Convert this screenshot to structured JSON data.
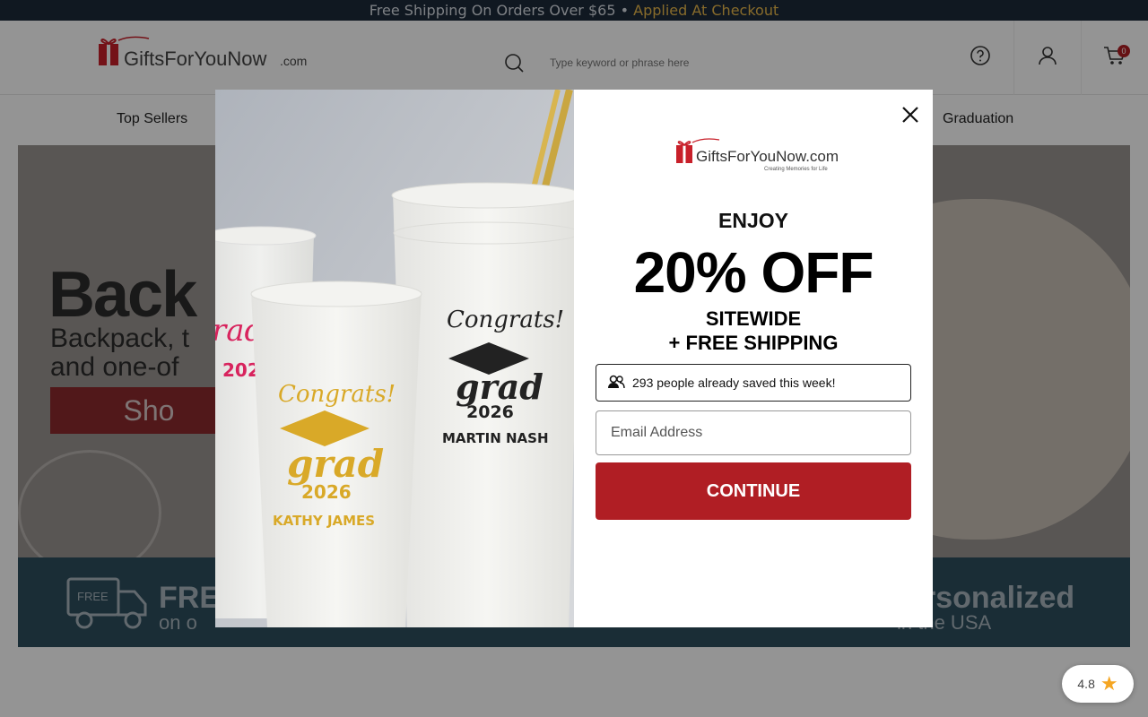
{
  "promo_bar": {
    "text": "Free Shipping On Orders Over $65 •",
    "highlight": "Applied At Checkout"
  },
  "header": {
    "logo_text": "GiftsForYouNow",
    "logo_suffix": ".com",
    "search_placeholder": "Type keyword or phrase here",
    "cart_count": "0"
  },
  "nav": {
    "items": [
      "Top Sellers",
      "Graduation"
    ]
  },
  "hero": {
    "title": "Back",
    "subtitle_line1": "Backpack, t",
    "subtitle_line2": "and one-of",
    "button": "Sho"
  },
  "usp": {
    "free_title": "FRE",
    "free_sub": "on o",
    "truck_label": "FREE",
    "personalized_title": "rsonalized",
    "personalized_sub": "in the USA"
  },
  "modal": {
    "logo_text": "GiftsForYouNow.com",
    "logo_tagline": "Creating Memories for Life",
    "enjoy": "ENJOY",
    "discount": "20% OFF",
    "sitewide": "SITEWIDE",
    "free_shipping": "+ FREE SHIPPING",
    "social_proof": "293 people already saved this week!",
    "email_placeholder": "Email Address",
    "continue_label": "CONTINUE",
    "cups": {
      "front_congrats": "Congrats!",
      "front_grad": "grad",
      "front_year": "2026",
      "front_name": "KATHY JAMES",
      "back_congrats": "Congrats!",
      "back_grad": "grad",
      "back_year": "2026",
      "back_name": "MARTIN NASH"
    }
  },
  "rating_widget": {
    "score": "4.8"
  },
  "colors": {
    "brand_red": "#b01e24",
    "promo_bg": "#1d2a3a",
    "promo_highlight": "#e8b84a",
    "usp_bg": "#2d4e5e"
  }
}
